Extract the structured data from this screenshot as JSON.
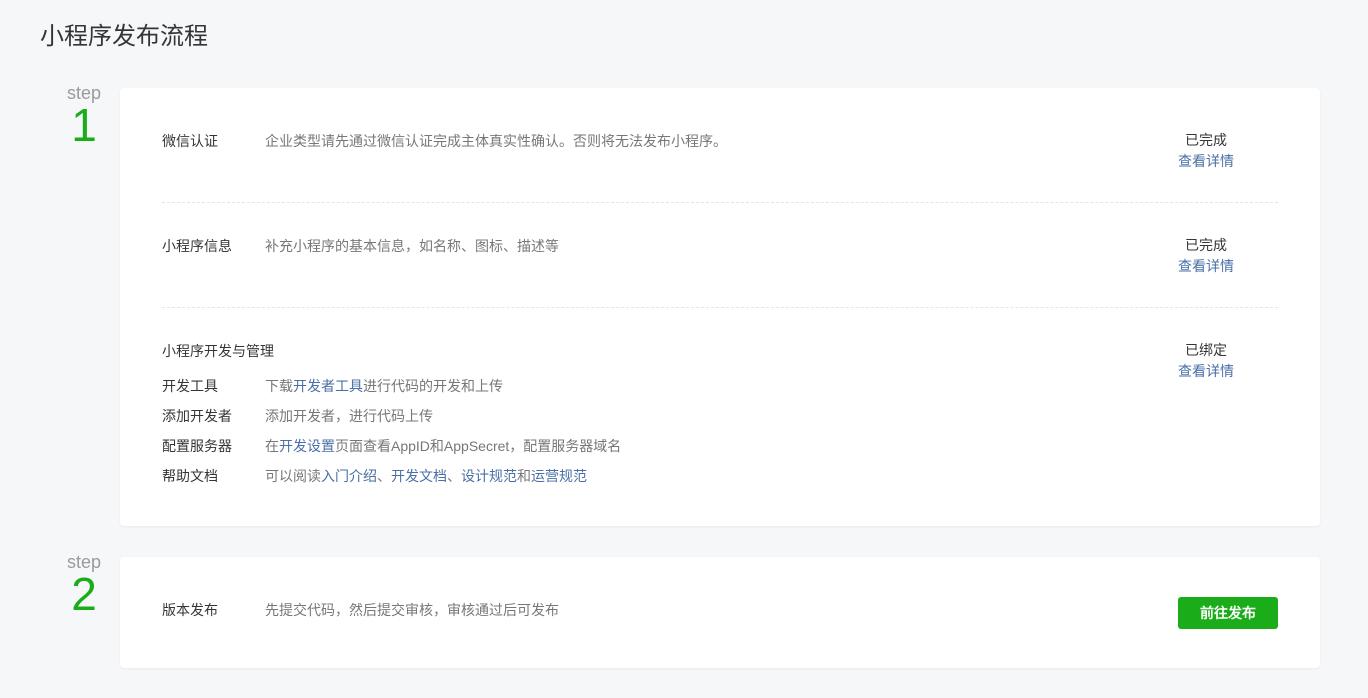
{
  "title": "小程序发布流程",
  "steps": [
    {
      "word": "step",
      "number": "1"
    },
    {
      "word": "step",
      "number": "2"
    }
  ],
  "step1": {
    "rows": [
      {
        "label": "微信认证",
        "desc": "企业类型请先通过微信认证完成主体真实性确认。否则将无法发布小程序。",
        "status": "已完成",
        "link": "查看详情"
      },
      {
        "label": "小程序信息",
        "desc": "补充小程序的基本信息，如名称、图标、描述等",
        "status": "已完成",
        "link": "查看详情"
      }
    ],
    "dev": {
      "label": "小程序开发与管理",
      "status": "已绑定",
      "link": "查看详情",
      "items": [
        {
          "label": "开发工具",
          "segments": [
            {
              "text": "下载"
            },
            {
              "text": "开发者工具",
              "link": true
            },
            {
              "text": "进行代码的开发和上传"
            }
          ]
        },
        {
          "label": "添加开发者",
          "segments": [
            {
              "text": "添加开发者，进行代码上传"
            }
          ]
        },
        {
          "label": "配置服务器",
          "segments": [
            {
              "text": "在"
            },
            {
              "text": "开发设置",
              "link": true
            },
            {
              "text": "页面查看AppID和AppSecret，配置服务器域名"
            }
          ]
        },
        {
          "label": "帮助文档",
          "segments": [
            {
              "text": "可以阅读"
            },
            {
              "text": "入门介绍",
              "link": true
            },
            {
              "text": "、"
            },
            {
              "text": "开发文档",
              "link": true
            },
            {
              "text": "、"
            },
            {
              "text": "设计规范",
              "link": true
            },
            {
              "text": "和"
            },
            {
              "text": "运营规范",
              "link": true
            }
          ]
        }
      ]
    }
  },
  "step2": {
    "label": "版本发布",
    "desc": "先提交代码，然后提交审核，审核通过后可发布",
    "button": "前往发布"
  }
}
